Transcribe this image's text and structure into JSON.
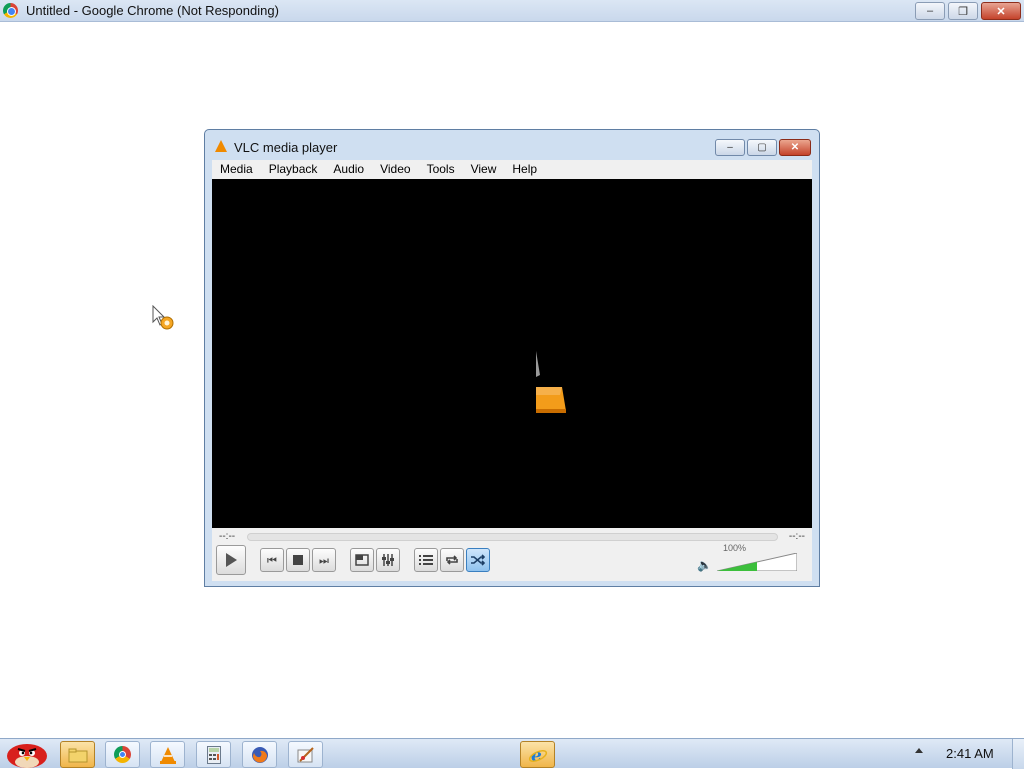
{
  "browser": {
    "title": "Untitled - Google Chrome (Not Responding)",
    "buttons": {
      "minimize": "–",
      "restore": "❐",
      "close": "✕"
    }
  },
  "vlc": {
    "title": "VLC media player",
    "window_buttons": {
      "minimize": "–",
      "maximize": "▢",
      "close": "✕"
    },
    "menu": [
      "Media",
      "Playback",
      "Audio",
      "Video",
      "Tools",
      "View",
      "Help"
    ],
    "time_elapsed": "--:--",
    "time_total": "--:--",
    "volume_percent": "100%",
    "volume_level": 1.0,
    "controls": {
      "play": "play-icon",
      "previous": "⏮",
      "stop": "stop-icon",
      "next": "⏭",
      "fullscreen": "fullscreen-icon",
      "extended": "equalizer-icon",
      "playlist": "playlist-icon",
      "loop": "loop-icon",
      "random": "shuffle-icon"
    },
    "random_active": true
  },
  "taskbar": {
    "clock": "2:41 AM",
    "apps": [
      "start-orb",
      "file-explorer",
      "chrome",
      "vlc",
      "calculator",
      "firefox",
      "paint",
      "internet-explorer"
    ]
  },
  "colors": {
    "vlc_orange": "#f08a00",
    "volume_green": "#3cbf3c",
    "video_bg": "#000000"
  }
}
